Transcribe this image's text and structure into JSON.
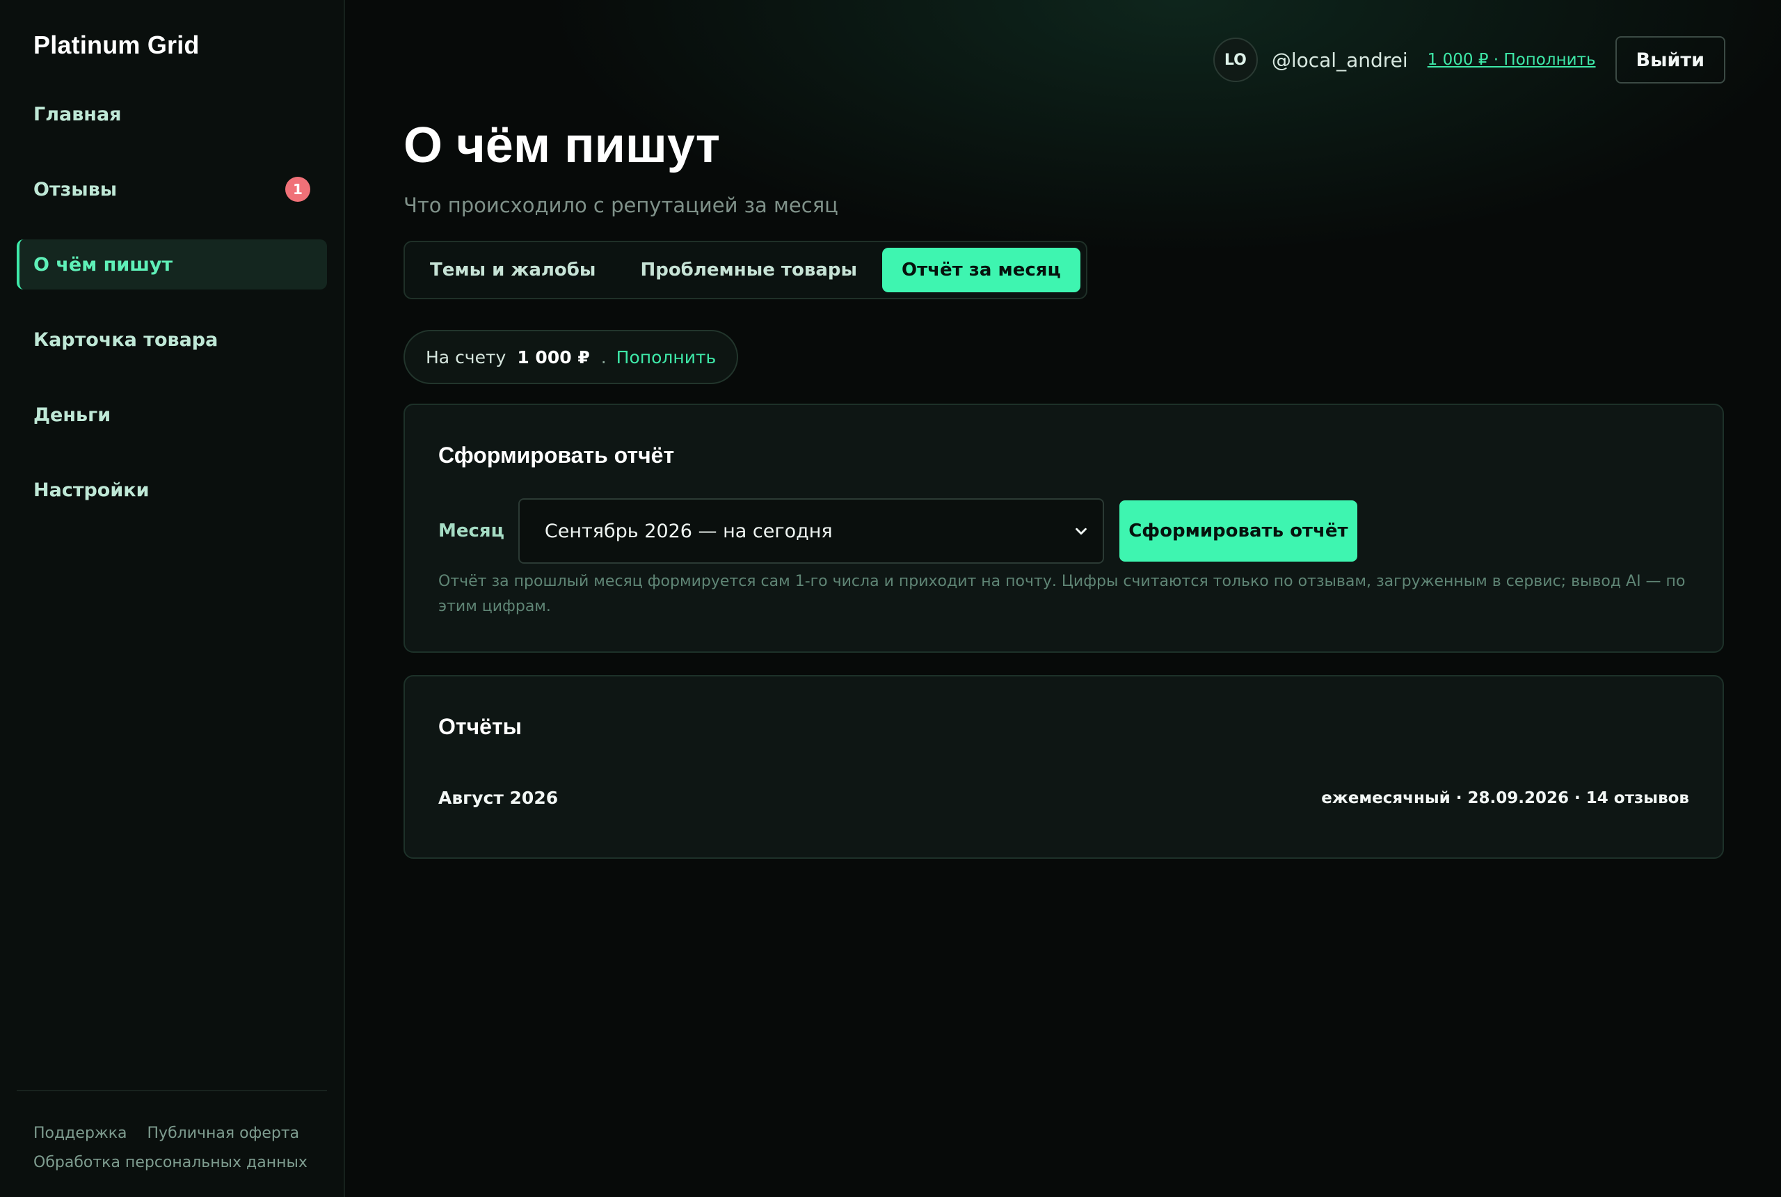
{
  "brand": "Platinum Grid",
  "sidebar": {
    "items": [
      {
        "label": "Главная"
      },
      {
        "label": "Отзывы",
        "badge": "1"
      },
      {
        "label": "О чём пишут"
      },
      {
        "label": "Карточка товара"
      },
      {
        "label": "Деньги"
      },
      {
        "label": "Настройки"
      }
    ],
    "active_index": 2,
    "footer": {
      "support": "Поддержка",
      "offer": "Публичная оферта",
      "privacy": "Обработка персональных данных"
    }
  },
  "header": {
    "avatar_initials": "LO",
    "username": "@local_andrei",
    "balance_link": "1 000 ₽ · Пополнить",
    "logout_label": "Выйти"
  },
  "page": {
    "title": "О чём пишут",
    "subtitle": "Что происходило с репутацией за месяц"
  },
  "tabs": [
    {
      "label": "Темы и жалобы"
    },
    {
      "label": "Проблемные товары"
    },
    {
      "label": "Отчёт за месяц"
    }
  ],
  "active_tab": 2,
  "balance_pill": {
    "label": "На счету",
    "amount": "1 000 ₽",
    "separator": ".",
    "topup": "Пополнить"
  },
  "generate": {
    "title": "Сформировать отчёт",
    "month_label": "Месяц",
    "selected_month": "Сентябрь 2026 — на сегодня",
    "button_label": "Сформировать отчёт",
    "hint": "Отчёт за прошлый месяц формируется сам 1-го числа и приходит на почту. Цифры считаются только по отзывам, загруженным в сервис; вывод AI — по этим цифрам."
  },
  "reports": {
    "title": "Отчёты",
    "items": [
      {
        "name": "Август 2026",
        "meta": "ежемесячный · 28.09.2026 · 14 отзывов"
      }
    ]
  },
  "colors": {
    "accent": "#3ef5b0",
    "badge": "#f07178",
    "background": "#070a09",
    "card": "#0e1614"
  }
}
